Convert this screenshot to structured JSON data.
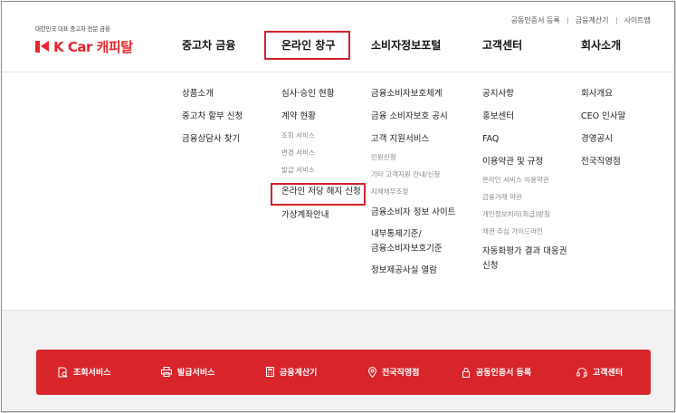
{
  "header": {
    "tagline": "대한민국 대표 중고차 전문 금융",
    "brand": "K Car 캐피탈",
    "top_links": [
      "공동인증서 등록",
      "금융계산기",
      "사이트맵"
    ]
  },
  "nav": {
    "menus": [
      {
        "title": "중고차 금융",
        "items": [
          {
            "label": "상품소개",
            "type": "m"
          },
          {
            "label": "중고차 할부 신청",
            "type": "m"
          },
          {
            "label": "금융상담사 찾기",
            "type": "m"
          }
        ]
      },
      {
        "title": "온라인 창구",
        "items": [
          {
            "label": "심사·승인 현황",
            "type": "m"
          },
          {
            "label": "계약 현황",
            "type": "m"
          },
          {
            "label": "조회 서비스",
            "type": "s"
          },
          {
            "label": "변경 서비스",
            "type": "s"
          },
          {
            "label": "발급 서비스",
            "type": "s"
          },
          {
            "label": "온라인 저당 해지 신청",
            "type": "m"
          },
          {
            "label": "가상계좌안내",
            "type": "m"
          }
        ]
      },
      {
        "title": "소비자정보포털",
        "items": [
          {
            "label": "금융소비자보호체계",
            "type": "m"
          },
          {
            "label": "금융 소비자보호 공시",
            "type": "m"
          },
          {
            "label": "고객 지원서비스",
            "type": "m"
          },
          {
            "label": "민원신청",
            "type": "s"
          },
          {
            "label": "기타 고객지원 안내/신청",
            "type": "s"
          },
          {
            "label": "자체채무조정",
            "type": "s"
          },
          {
            "label": "금융소비자 정보 사이트",
            "type": "m"
          },
          {
            "label": "내부통제기준/",
            "type": "m"
          },
          {
            "label": "금융소비자보호기준",
            "type": "m"
          },
          {
            "label": "정보제공사실 열람",
            "type": "m"
          }
        ]
      },
      {
        "title": "고객센터",
        "items": [
          {
            "label": "공지사항",
            "type": "m"
          },
          {
            "label": "홍보센터",
            "type": "m"
          },
          {
            "label": "FAQ",
            "type": "m"
          },
          {
            "label": "이용약관 및 규정",
            "type": "m"
          },
          {
            "label": "온라인 서비스 이용약관",
            "type": "s"
          },
          {
            "label": "금융거래 약관",
            "type": "s"
          },
          {
            "label": "개인정보처리(취급)방침",
            "type": "s"
          },
          {
            "label": "채권 추심 가이드라인",
            "type": "s"
          },
          {
            "label": "자동화평가 결과 대응권",
            "type": "m"
          },
          {
            "label": "신청",
            "type": "m"
          }
        ]
      },
      {
        "title": "회사소개",
        "items": [
          {
            "label": "회사개요",
            "type": "m"
          },
          {
            "label": "CEO 인사말",
            "type": "m"
          },
          {
            "label": "경영공시",
            "type": "m"
          },
          {
            "label": "전국직영점",
            "type": "m"
          }
        ]
      }
    ]
  },
  "quickbar": {
    "items": [
      {
        "label": "조회서비스",
        "icon": "inquiry-icon"
      },
      {
        "label": "발급서비스",
        "icon": "printer-icon"
      },
      {
        "label": "금융계산기",
        "icon": "calculator-icon"
      },
      {
        "label": "전국직영점",
        "icon": "location-pin-icon"
      },
      {
        "label": "공동인증서 등록",
        "icon": "certificate-icon"
      },
      {
        "label": "고객센터",
        "icon": "headset-icon"
      }
    ]
  },
  "colors": {
    "brand_red": "#d8252c",
    "highlight_border": "#d0232d"
  }
}
